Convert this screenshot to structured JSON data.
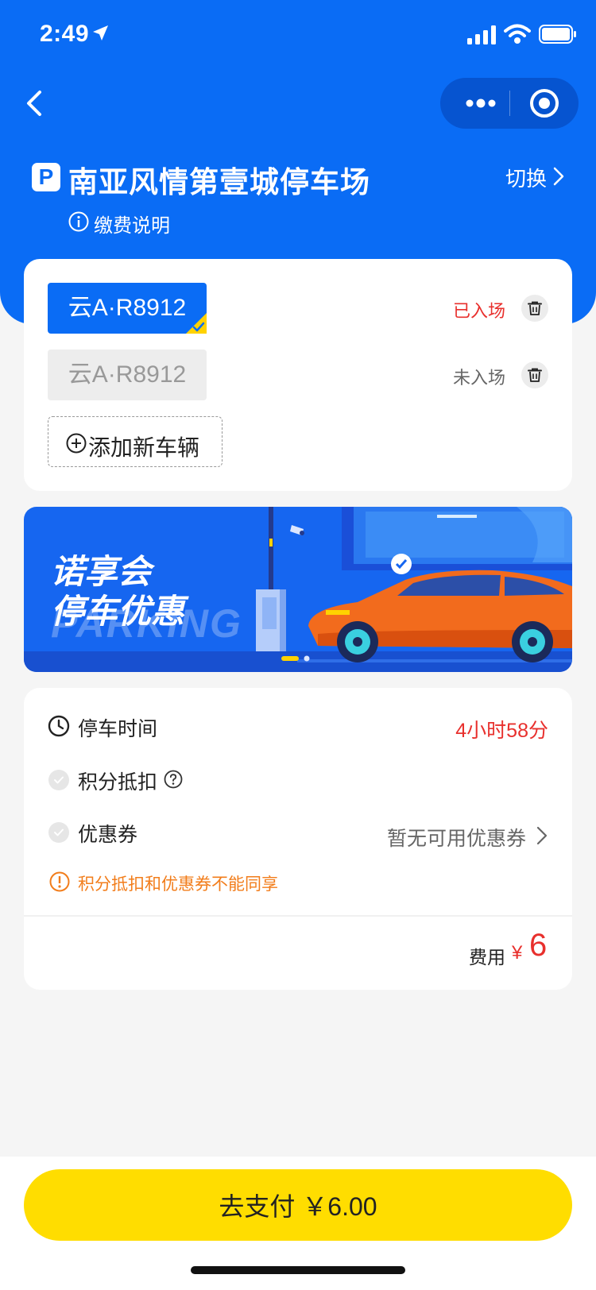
{
  "status_bar": {
    "time": "2:49"
  },
  "lot": {
    "icon_letter": "P",
    "name": "南亚风情第壹城停车场",
    "switch_label": "切换",
    "fee_info_label": "缴费说明"
  },
  "vehicles": {
    "items": [
      {
        "plate": "云A·R8912",
        "status": "已入场",
        "selected": true
      },
      {
        "plate": "云A·R8912",
        "status": "未入场",
        "selected": false
      }
    ],
    "add_label": "添加新车辆"
  },
  "banner": {
    "line1": "诺享会",
    "line2": "停车优惠",
    "watermark": "PARKING"
  },
  "details": {
    "parking_time_label": "停车时间",
    "parking_time_value": "4小时58分",
    "points_label": "积分抵扣",
    "coupon_label": "优惠券",
    "coupon_value": "暂无可用优惠券",
    "notice": "积分抵扣和优惠券不能同享",
    "fee_label": "费用",
    "fee_currency": "¥",
    "fee_value": "6"
  },
  "pay_button": {
    "label": "去支付 ￥6.00"
  },
  "colors": {
    "primary": "#0a6cf5",
    "accent_red": "#e8302d",
    "warning": "#f27d1b",
    "pay_yellow": "#ffdd00"
  }
}
